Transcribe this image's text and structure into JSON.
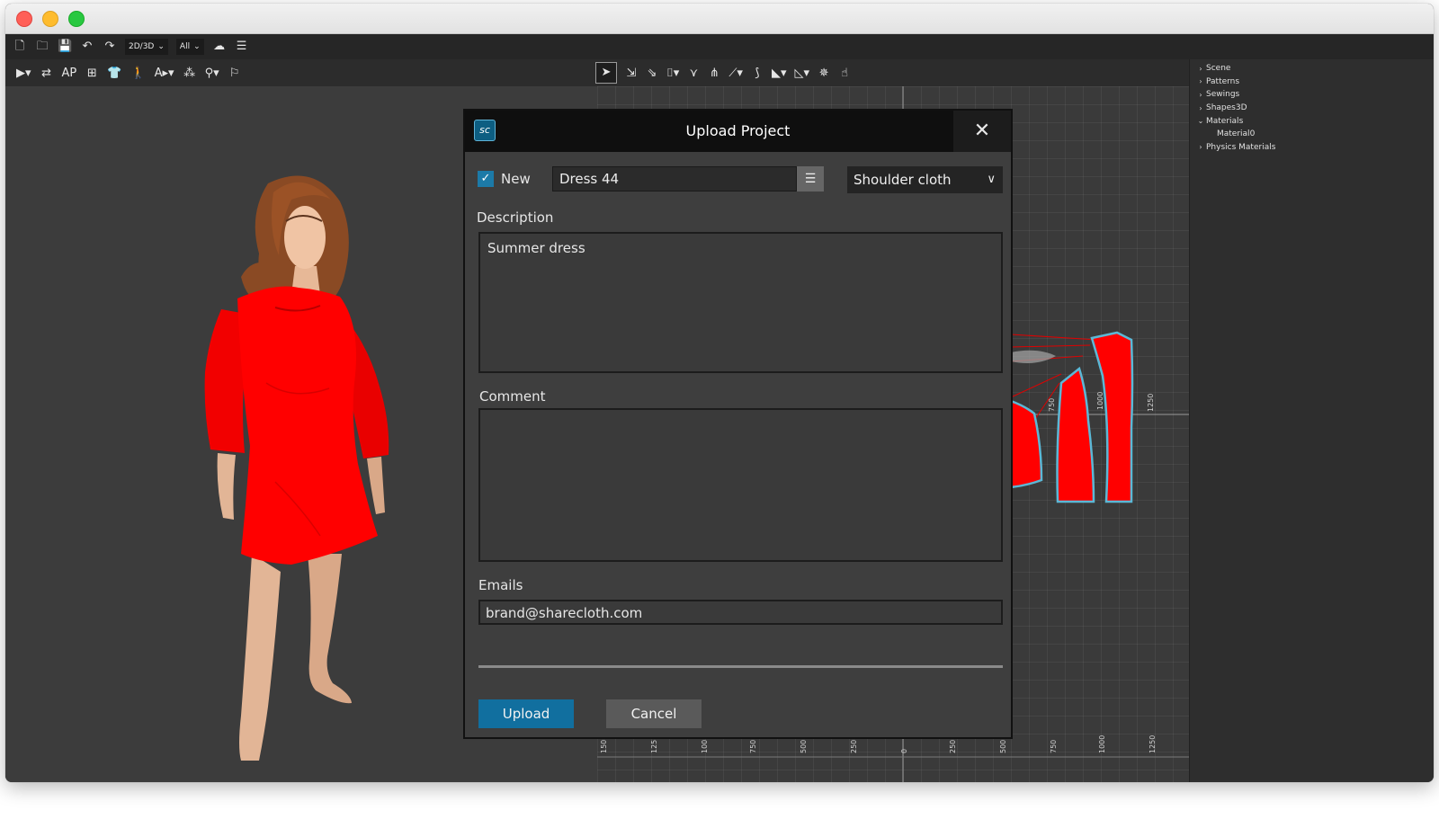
{
  "toolbar": {
    "mode_select": "2D/3D",
    "filter_select": "All"
  },
  "scene_tree": {
    "items": [
      {
        "label": "Scene",
        "expanded": false,
        "indent": 0
      },
      {
        "label": "Patterns",
        "expanded": false,
        "indent": 0
      },
      {
        "label": "Sewings",
        "expanded": false,
        "indent": 0
      },
      {
        "label": "Shapes3D",
        "expanded": false,
        "indent": 0
      },
      {
        "label": "Materials",
        "expanded": true,
        "indent": 0
      },
      {
        "label": "Material0",
        "expanded": null,
        "indent": 1
      },
      {
        "label": "Physics Materials",
        "expanded": false,
        "indent": 0
      }
    ]
  },
  "ruler": {
    "bottom_ticks": [
      "150",
      "125",
      "100",
      "750",
      "500",
      "250",
      "0",
      "250",
      "500",
      "750",
      "1000",
      "1250"
    ],
    "pattern_ticks": [
      "750",
      "1000",
      "1250"
    ]
  },
  "dialog": {
    "title": "Upload Project",
    "new_label": "New",
    "new_checked": true,
    "project_name": "Dress 44",
    "category": "Shoulder cloth",
    "description_label": "Description",
    "description": "Summer dress",
    "comment_label": "Comment",
    "comment": "",
    "emails_label": "Emails",
    "emails": "brand@sharecloth.com",
    "progress": 0,
    "upload_label": "Upload",
    "cancel_label": "Cancel",
    "logo_text": "sc"
  },
  "colors": {
    "accent": "#116f9f",
    "garment": "#ff0000",
    "pattern_outline": "#5bb8d6"
  }
}
